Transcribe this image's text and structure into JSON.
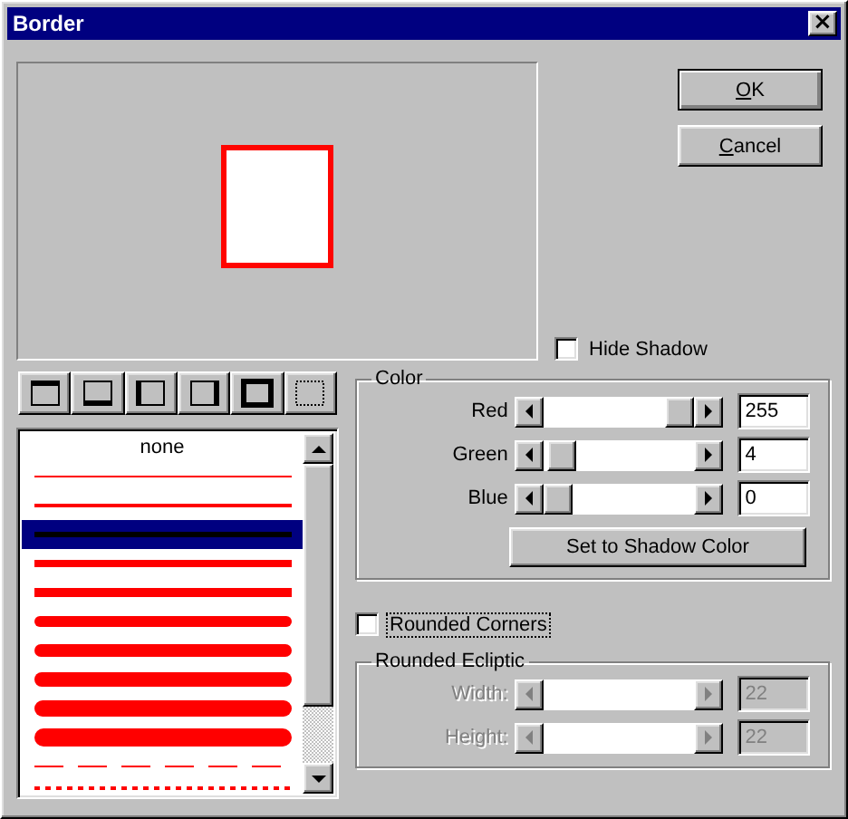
{
  "window": {
    "title": "Border",
    "close": "×"
  },
  "buttons": [
    {
      "label": "OK",
      "default": true
    },
    {
      "label": "Cancel",
      "default": false
    }
  ],
  "hide_shadow": {
    "label": "Hide Shadow",
    "checked": false
  },
  "border_buttons": [
    {
      "kind": "top"
    },
    {
      "kind": "bottom"
    },
    {
      "kind": "left"
    },
    {
      "kind": "right"
    },
    {
      "kind": "all"
    },
    {
      "kind": "dotted"
    }
  ],
  "line_styles": [
    {
      "kind": "none",
      "label": "none",
      "selected": false
    },
    {
      "kind": "hairline",
      "selected": false
    },
    {
      "kind": "thin",
      "selected": false
    },
    {
      "kind": "medium",
      "selected": true
    },
    {
      "kind": "thick",
      "selected": false
    },
    {
      "kind": "heavy",
      "selected": false
    },
    {
      "kind": "roundthin",
      "selected": false
    },
    {
      "kind": "roundmedium",
      "selected": false
    },
    {
      "kind": "roundthick",
      "selected": false
    },
    {
      "kind": "roundheavy",
      "selected": false
    },
    {
      "kind": "roundbold",
      "selected": false
    },
    {
      "kind": "dashed",
      "selected": false
    },
    {
      "kind": "dotted",
      "selected": false
    }
  ],
  "color": {
    "title": "Color",
    "channels": [
      {
        "label": "Red",
        "level": 1,
        "value": "255"
      },
      {
        "label": "Green",
        "level": 0.02,
        "value": "4"
      },
      {
        "label": "Blue",
        "level": 0,
        "value": "0"
      }
    ],
    "button": "Set to Shadow Color"
  },
  "rounded_corners": {
    "label": "Rounded Corners",
    "checked": false,
    "focused": true
  },
  "rounded_ecliptic": {
    "title": "Rounded Ecliptic",
    "fields": [
      {
        "label": "Width:",
        "value": "22",
        "disabled": true
      },
      {
        "label": "Height:",
        "value": "22",
        "disabled": true
      }
    ]
  }
}
